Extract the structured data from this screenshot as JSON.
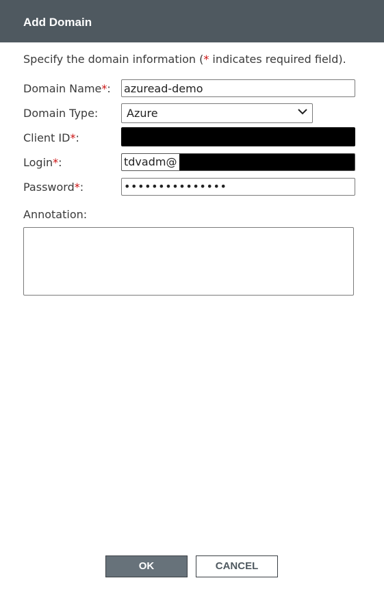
{
  "dialog": {
    "title": "Add Domain",
    "intro_before": "Specify the domain information (",
    "required_marker": "*",
    "intro_after": " indicates required field)."
  },
  "fields": {
    "domain_name": {
      "label": "Domain Name",
      "value": "azuread-demo"
    },
    "domain_type": {
      "label": "Domain Type:",
      "value": "Azure"
    },
    "client_id": {
      "label": "Client ID",
      "value": ""
    },
    "login": {
      "label": "Login",
      "value": "tdvadm@"
    },
    "password": {
      "label": "Password",
      "value": "•••••••••••••••"
    },
    "annotation": {
      "label": "Annotation:",
      "value": ""
    }
  },
  "buttons": {
    "ok": "OK",
    "cancel": "CANCEL"
  },
  "colors": {
    "title_bar": "#4f5960",
    "required": "#cc1111",
    "ok_button": "#67727a"
  }
}
